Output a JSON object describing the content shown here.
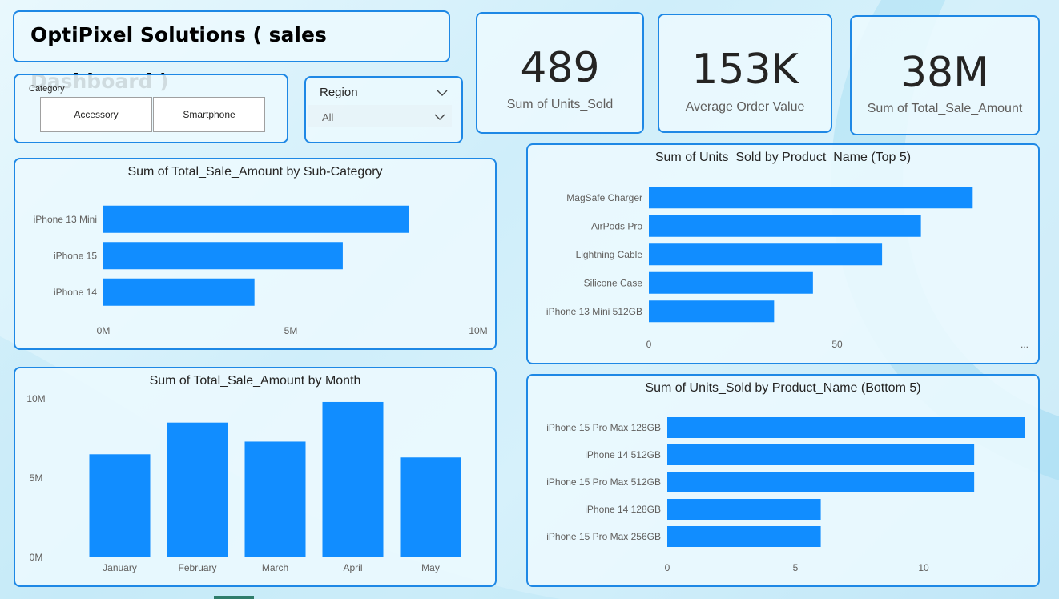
{
  "title": "OptiPixel Solutions ( sales Dashboard )",
  "kpis": [
    {
      "value": "489",
      "label": "Sum of Units_Sold"
    },
    {
      "value": "153K",
      "label": "Average Order Value"
    },
    {
      "value": "38M",
      "label": "Sum of Total_Sale_Amount"
    }
  ],
  "category_slicer": {
    "header": "Category",
    "options": [
      "Accessory",
      "Smartphone"
    ]
  },
  "region_slicer": {
    "header": "Region",
    "selected": "All"
  },
  "colors": {
    "accent": "#1e88e5",
    "bar": "#118dff"
  },
  "charts": {
    "subcategory": {
      "title": "Sum of Total_Sale_Amount by Sub-Category",
      "tick_labels": [
        "0M",
        "5M",
        "10M"
      ]
    },
    "month": {
      "title": "Sum of Total_Sale_Amount by Month",
      "tick_labels": [
        "10M",
        "5M",
        "0M"
      ]
    },
    "top5": {
      "title": "Sum of Units_Sold by Product_Name (Top 5)",
      "tick_labels": [
        "0",
        "50",
        "..."
      ]
    },
    "bottom5": {
      "title": "Sum of Units_Sold by Product_Name (Bottom 5)",
      "tick_labels": [
        "0",
        "5",
        "10"
      ]
    }
  },
  "chart_data": [
    {
      "type": "bar",
      "orientation": "horizontal",
      "title": "Sum of Total_Sale_Amount by Sub-Category",
      "categories": [
        "iPhone 13 Mini",
        "iPhone 15",
        "iPhone 14"
      ],
      "values": [
        9000000,
        7050000,
        4450000
      ],
      "xlim": [
        0,
        10000000
      ]
    },
    {
      "type": "bar",
      "orientation": "vertical",
      "title": "Sum of Total_Sale_Amount by Month",
      "categories": [
        "January",
        "February",
        "March",
        "April",
        "May"
      ],
      "values": [
        6500000,
        8500000,
        7300000,
        9800000,
        6300000
      ],
      "ylim": [
        0,
        10000000
      ]
    },
    {
      "type": "bar",
      "orientation": "horizontal",
      "title": "Sum of Units_Sold by Product_Name (Top 5)",
      "categories": [
        "MagSafe Charger",
        "AirPods Pro",
        "Lightning Cable",
        "Silicone Case",
        "iPhone 13 Mini 512GB"
      ],
      "values": [
        75,
        63,
        54,
        38,
        29
      ],
      "xlim": [
        0,
        87
      ]
    },
    {
      "type": "bar",
      "orientation": "horizontal",
      "title": "Sum of Units_Sold by Product_Name (Bottom 5)",
      "categories": [
        "iPhone 15 Pro Max 128GB",
        "iPhone 14 512GB",
        "iPhone 15 Pro Max 512GB",
        "iPhone 14 128GB",
        "iPhone 15 Pro Max 256GB"
      ],
      "values": [
        14,
        12,
        12,
        6,
        6
      ],
      "xlim": [
        0,
        14
      ]
    }
  ]
}
